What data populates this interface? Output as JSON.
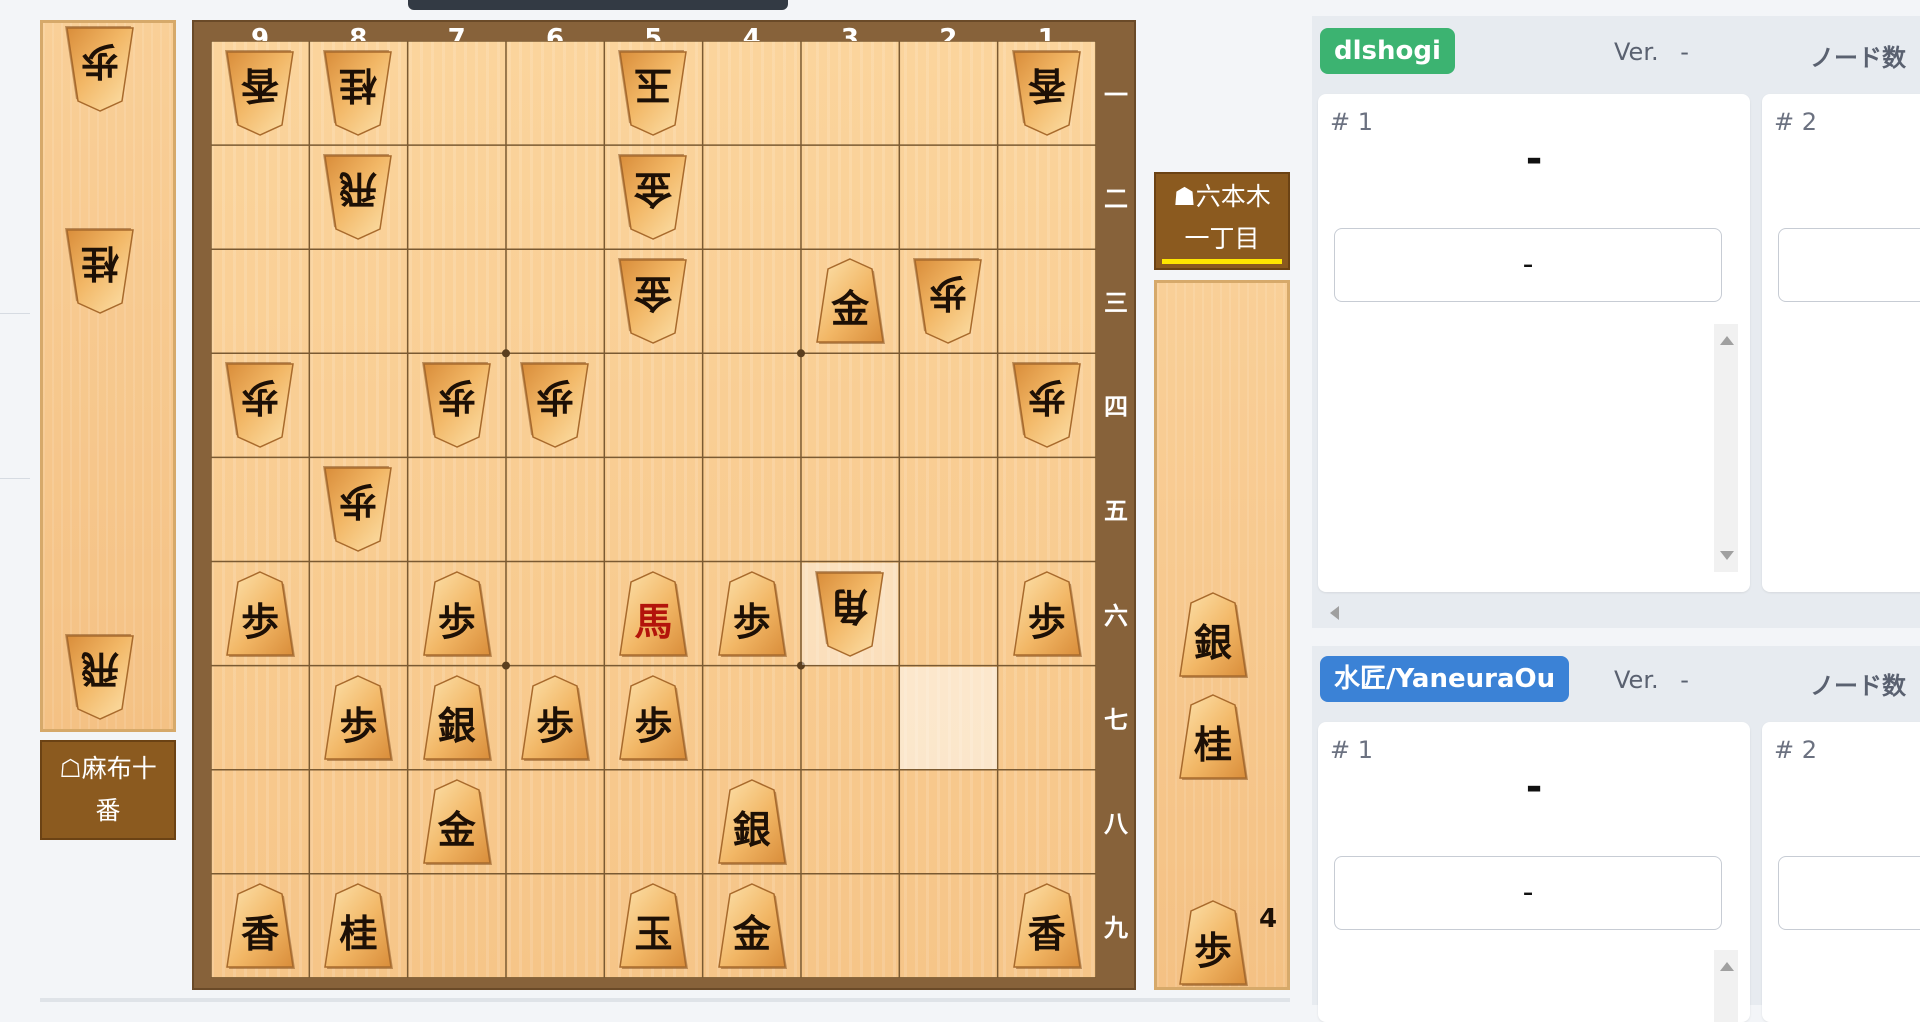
{
  "colors": {
    "board": "#f6c588",
    "frame": "#87623a",
    "nameplate": "#8b5a1f",
    "turn_indicator": "#ffe600",
    "engine1_badge": "#3cb371",
    "engine2_badge": "#3b82d6"
  },
  "board": {
    "files": [
      "9",
      "8",
      "7",
      "6",
      "5",
      "4",
      "3",
      "2",
      "1"
    ],
    "ranks": [
      "一",
      "二",
      "三",
      "四",
      "五",
      "六",
      "七",
      "八",
      "九"
    ],
    "last_move_square": {
      "file": 3,
      "rank": 6
    },
    "highlight_square": {
      "file": 2,
      "rank": 7
    },
    "pieces": [
      {
        "file": 9,
        "rank": 1,
        "label": "香",
        "side": "gote"
      },
      {
        "file": 8,
        "rank": 1,
        "label": "桂",
        "side": "gote"
      },
      {
        "file": 5,
        "rank": 1,
        "label": "玉",
        "side": "gote"
      },
      {
        "file": 1,
        "rank": 1,
        "label": "香",
        "side": "gote"
      },
      {
        "file": 8,
        "rank": 2,
        "label": "飛",
        "side": "gote"
      },
      {
        "file": 5,
        "rank": 2,
        "label": "金",
        "side": "gote"
      },
      {
        "file": 5,
        "rank": 3,
        "label": "金",
        "side": "gote"
      },
      {
        "file": 3,
        "rank": 3,
        "label": "金",
        "side": "sente"
      },
      {
        "file": 2,
        "rank": 3,
        "label": "歩",
        "side": "gote"
      },
      {
        "file": 9,
        "rank": 4,
        "label": "歩",
        "side": "gote"
      },
      {
        "file": 7,
        "rank": 4,
        "label": "歩",
        "side": "gote"
      },
      {
        "file": 6,
        "rank": 4,
        "label": "歩",
        "side": "gote"
      },
      {
        "file": 1,
        "rank": 4,
        "label": "歩",
        "side": "gote"
      },
      {
        "file": 8,
        "rank": 5,
        "label": "歩",
        "side": "gote"
      },
      {
        "file": 9,
        "rank": 6,
        "label": "歩",
        "side": "sente"
      },
      {
        "file": 7,
        "rank": 6,
        "label": "歩",
        "side": "sente"
      },
      {
        "file": 5,
        "rank": 6,
        "label": "馬",
        "side": "sente"
      },
      {
        "file": 4,
        "rank": 6,
        "label": "歩",
        "side": "sente"
      },
      {
        "file": 3,
        "rank": 6,
        "label": "角",
        "side": "gote"
      },
      {
        "file": 1,
        "rank": 6,
        "label": "歩",
        "side": "sente"
      },
      {
        "file": 8,
        "rank": 7,
        "label": "歩",
        "side": "sente"
      },
      {
        "file": 7,
        "rank": 7,
        "label": "銀",
        "side": "sente"
      },
      {
        "file": 6,
        "rank": 7,
        "label": "歩",
        "side": "sente"
      },
      {
        "file": 5,
        "rank": 7,
        "label": "歩",
        "side": "sente"
      },
      {
        "file": 7,
        "rank": 8,
        "label": "金",
        "side": "sente"
      },
      {
        "file": 4,
        "rank": 8,
        "label": "銀",
        "side": "sente"
      },
      {
        "file": 9,
        "rank": 9,
        "label": "香",
        "side": "sente"
      },
      {
        "file": 8,
        "rank": 9,
        "label": "桂",
        "side": "sente"
      },
      {
        "file": 5,
        "rank": 9,
        "label": "玉",
        "side": "sente"
      },
      {
        "file": 4,
        "rank": 9,
        "label": "金",
        "side": "sente"
      },
      {
        "file": 1,
        "rank": 9,
        "label": "香",
        "side": "sente"
      }
    ]
  },
  "gote": {
    "name_line1": "☖麻布十",
    "name_line2": "番",
    "hand": [
      {
        "label": "歩",
        "count": ""
      },
      {
        "label": "桂",
        "count": ""
      },
      {
        "label": "飛",
        "count": ""
      }
    ]
  },
  "sente": {
    "name_line1": "☗六本木",
    "name_line2": "一丁目",
    "hand": [
      {
        "label": "銀",
        "count": ""
      },
      {
        "label": "桂",
        "count": ""
      },
      {
        "label": "歩",
        "count": "4"
      }
    ]
  },
  "engines": [
    {
      "name": "dlshogi",
      "ver_label": "Ver.",
      "ver_value": "-",
      "nodes_label": "ノード数",
      "pvs": [
        {
          "num": "# 1",
          "eval": "-",
          "move": "-"
        },
        {
          "num": "# 2",
          "eval": "",
          "move": ""
        }
      ]
    },
    {
      "name": "水匠/YaneuraOu",
      "ver_label": "Ver.",
      "ver_value": "-",
      "nodes_label": "ノード数",
      "pvs": [
        {
          "num": "# 1",
          "eval": "-",
          "move": "-"
        },
        {
          "num": "# 2",
          "eval": "",
          "move": ""
        }
      ]
    }
  ]
}
